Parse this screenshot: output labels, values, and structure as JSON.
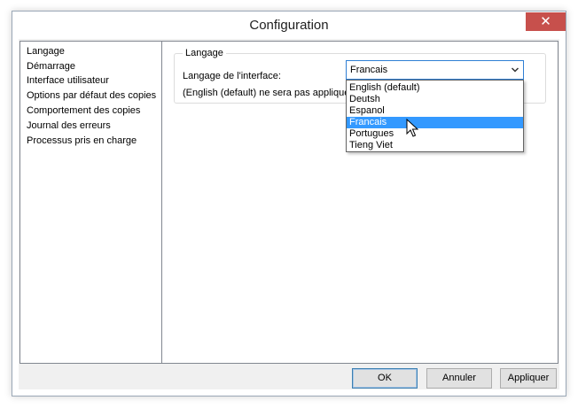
{
  "window": {
    "title": "Configuration",
    "close_glyph": "✕"
  },
  "sidebar": {
    "items": [
      {
        "label": "Langage"
      },
      {
        "label": "Démarrage"
      },
      {
        "label": "Interface utilisateur"
      },
      {
        "label": "Options par défaut des copies"
      },
      {
        "label": "Comportement des copies"
      },
      {
        "label": "Journal des erreurs"
      },
      {
        "label": "Processus pris en charge"
      }
    ]
  },
  "language_panel": {
    "group_label": "Langage",
    "field_label": "Langage de l'interface:",
    "note": "(English (default) ne sera pas appliqué avant",
    "select": {
      "value": "Francais",
      "options": [
        "English (default)",
        "Deutsh",
        "Espanol",
        "Francais",
        "Portugues",
        "Tieng Viet"
      ],
      "highlighted_option": "Francais",
      "arrow_icon": "chevron-down-icon"
    }
  },
  "buttons": {
    "ok": "OK",
    "cancel": "Annuler",
    "apply": "Appliquer"
  },
  "colors": {
    "highlight": "#3399ff",
    "close_button": "#c7504c",
    "focus_border": "#2f7fd4"
  }
}
